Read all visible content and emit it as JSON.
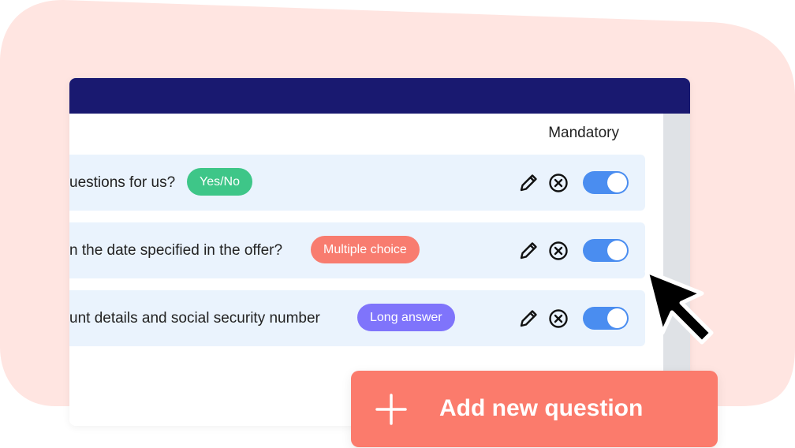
{
  "colors": {
    "background_blob": "#ffe5e1",
    "header": "#191970",
    "row_bg": "#eaf3fd",
    "toggle_on": "#4a8df0",
    "add_button": "#fb7b6c",
    "scrollbar": "#dfe2e6"
  },
  "table": {
    "mandatory_header": "Mandatory",
    "questions": [
      {
        "text": "uestions for us?",
        "type_label": "Yes/No",
        "type_color": "#3ec688",
        "mandatory": true,
        "edit_icon": "pencil-icon",
        "remove_icon": "circle-x-icon"
      },
      {
        "text": "n the date specified in the offer?",
        "type_label": "Multiple choice",
        "type_color": "#f87c6f",
        "mandatory": true,
        "edit_icon": "pencil-icon",
        "remove_icon": "circle-x-icon"
      },
      {
        "text": "unt details and social security number",
        "type_label": "Long answer",
        "type_color": "#7f74fb",
        "mandatory": true,
        "edit_icon": "pencil-icon",
        "remove_icon": "circle-x-icon"
      }
    ]
  },
  "add_question": {
    "label": "Add new question",
    "icon": "plus-icon"
  },
  "cursor": {
    "icon": "mouse-pointer-icon"
  }
}
